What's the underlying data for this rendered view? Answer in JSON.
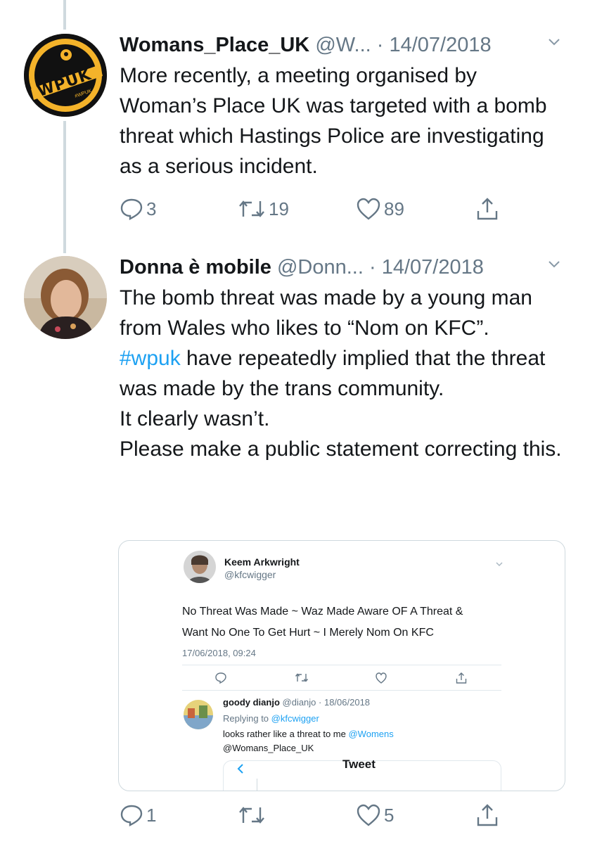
{
  "tweet1": {
    "avatar_text": "WPUK",
    "avatar_subtext": "#WPUK",
    "name": "Womans_Place_UK",
    "handle": "@W...",
    "date": "· 14/07/2018",
    "text": "More recently, a meeting organised by Woman’s Place UK was targeted with a bomb threat which Hastings Police are investigating as a serious incident.",
    "replies": "3",
    "retweets": "19",
    "likes": "89"
  },
  "tweet2": {
    "name": "Donna è mobile",
    "handle": "@Donn...",
    "date": "· 14/07/2018",
    "text_part1": "The bomb threat was made by a young man from Wales who likes to “Nom on KFC”.  ",
    "hashtag": "#wpuk",
    "text_part2": " have repeatedly implied that the threat was made by the trans community.\nIt clearly wasn’t.\nPlease make a public statement correcting this.",
    "replies": "1",
    "retweets": "",
    "likes": "5"
  },
  "embedded": {
    "name": "Keem Arkwright",
    "handle": "@kfcwigger",
    "text_line1": "No Threat Was Made ~ Waz Made Aware OF A Threat &",
    "text_line2": "Want No One To Get Hurt ~ I Merely Nom On KFC",
    "timestamp": "17/06/2018, 09:24",
    "reply": {
      "name": "goody dianjo",
      "handle_date": "@dianjo · 18/06/2018",
      "replying_to_label": "Replying to",
      "replying_to_handle": "@kfcwigger",
      "text": "looks rather like a threat to me",
      "mention1": "@Womens",
      "mention2": "@Womans_Place_UK"
    },
    "nested_header": "Tweet"
  },
  "colors": {
    "accent": "#1da1f2",
    "muted": "#657786",
    "wpuk_yellow": "#f4b32a"
  }
}
